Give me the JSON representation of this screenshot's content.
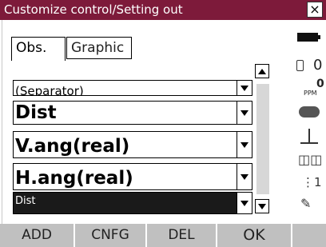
{
  "window": {
    "title": "Customize control/Setting out",
    "close_label": "×"
  },
  "tabs": [
    {
      "label": "Obs.",
      "active": true
    },
    {
      "label": "Graphic",
      "active": false
    }
  ],
  "rows": [
    {
      "label": "(Separator)"
    },
    {
      "label": "Dist"
    },
    {
      "label": "V.ang(real)"
    },
    {
      "label": "H.ang(real)"
    },
    {
      "label": "Dist",
      "selected": true
    }
  ],
  "status": {
    "sd_value": "0",
    "ppm_label": "PPM",
    "ppm_value": "0",
    "coord_label": "1"
  },
  "softkeys": [
    {
      "label": "ADD"
    },
    {
      "label": "CNFG"
    },
    {
      "label": "DEL"
    },
    {
      "label": "OK"
    },
    {
      "label": ""
    }
  ],
  "colors": {
    "title_bar": "#7d1a3a",
    "softkey_bg": "#c0c0c0",
    "selected_row": "#1a1a1a"
  }
}
